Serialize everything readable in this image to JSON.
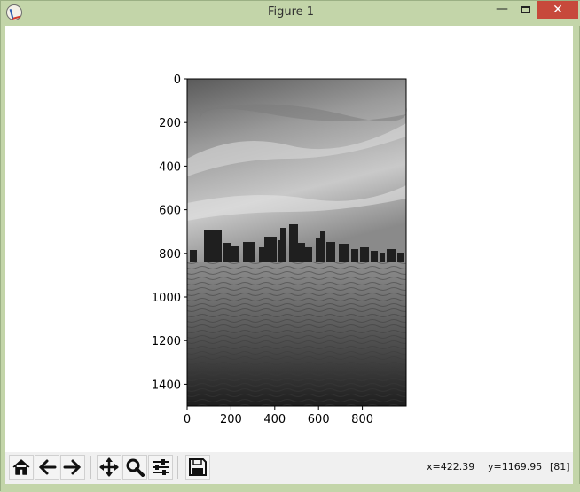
{
  "window": {
    "title": "Figure 1",
    "minimize_glyph": "—",
    "close_glyph": "✕",
    "accent_color": "#c3d5a9",
    "close_color": "#c7493b"
  },
  "figure": {
    "image_description_icon": "grayscale-city-skyline-photo",
    "y_ticks": [
      "0",
      "200",
      "400",
      "600",
      "800",
      "1000",
      "1200",
      "1400"
    ],
    "x_ticks": [
      "0",
      "200",
      "400",
      "600",
      "800"
    ]
  },
  "toolbar": {
    "buttons": [
      {
        "name": "home-icon"
      },
      {
        "name": "back-arrow-icon"
      },
      {
        "name": "forward-arrow-icon"
      },
      {
        "name": "pan-icon"
      },
      {
        "name": "zoom-icon"
      },
      {
        "name": "configure-subplots-icon"
      },
      {
        "name": "save-icon"
      }
    ],
    "x_readout": "x=422.39",
    "y_readout": "y=1169.95",
    "pixel_value": "[81]"
  }
}
